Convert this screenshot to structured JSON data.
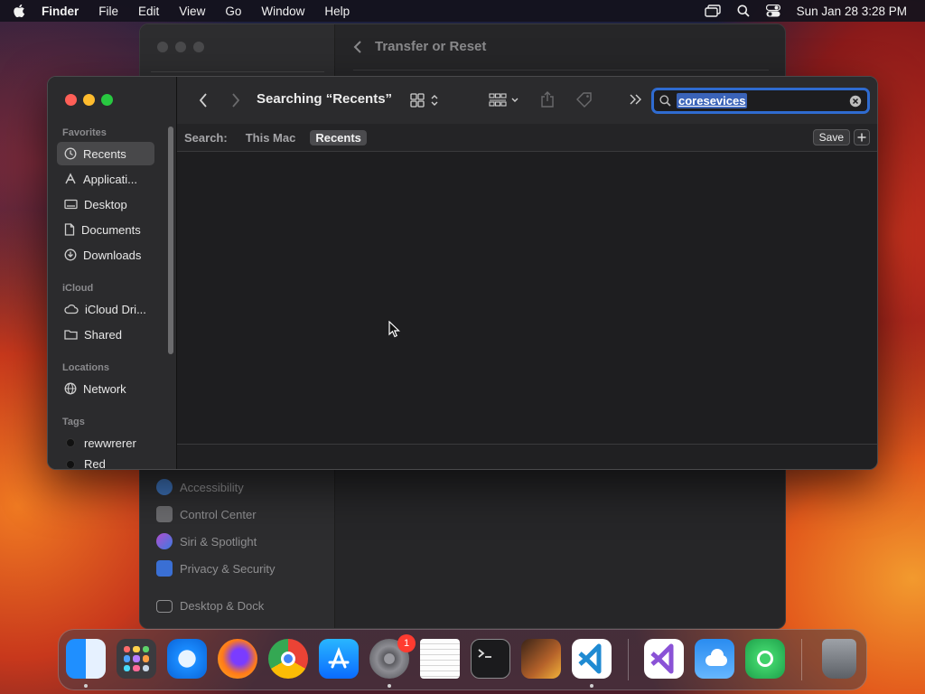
{
  "menubar": {
    "app_name": "Finder",
    "items": [
      "File",
      "Edit",
      "View",
      "Go",
      "Window",
      "Help"
    ],
    "clock": "Sun Jan 28  3:28 PM"
  },
  "background_window": {
    "title": "Transfer or Reset",
    "sidebar_items": [
      "Accessibility",
      "Control Center",
      "Siri & Spotlight",
      "Privacy & Security",
      "Desktop & Dock"
    ]
  },
  "finder": {
    "title": "Searching “Recents”",
    "search": {
      "value": "coresevices"
    },
    "scope": {
      "label": "Search:",
      "options": [
        "This Mac",
        "Recents"
      ],
      "selected": "Recents",
      "save_label": "Save"
    },
    "sidebar": {
      "favorites_title": "Favorites",
      "favorites": [
        "Recents",
        "Applicati...",
        "Desktop",
        "Documents",
        "Downloads"
      ],
      "icloud_title": "iCloud",
      "icloud": [
        "iCloud Dri...",
        "Shared"
      ],
      "locations_title": "Locations",
      "locations": [
        "Network"
      ],
      "tags_title": "Tags",
      "tags": [
        "rewwrerer",
        "Red"
      ]
    }
  },
  "dock": {
    "badge_settings": "1",
    "apps": [
      "finder-icon",
      "launchpad-icon",
      "safari-icon",
      "firefox-icon",
      "chrome-icon",
      "app-store-icon",
      "system-settings-icon",
      "textedit-icon",
      "terminal-icon",
      "garageband-icon",
      "vscode-icon",
      "visual-studio-icon",
      "weather-icon",
      "find-my-icon",
      "trash-icon"
    ]
  }
}
